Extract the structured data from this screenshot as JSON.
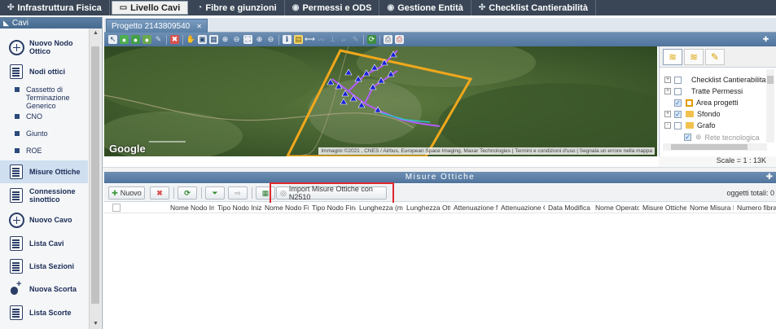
{
  "top_nav": {
    "items": [
      {
        "label": "Infrastruttura Fisica",
        "icon": "network-icon",
        "active": false
      },
      {
        "label": "Livello Cavi",
        "icon": "cable-icon",
        "active": true
      },
      {
        "label": "Fibre e giunzioni",
        "icon": "fiber-icon",
        "active": false
      },
      {
        "label": "Permessi e ODS",
        "icon": "permit-icon",
        "active": false
      },
      {
        "label": "Gestione Entità",
        "icon": "entity-icon",
        "active": false
      },
      {
        "label": "Checklist Cantierabilità",
        "icon": "checklist-icon",
        "active": false
      }
    ]
  },
  "sidebar": {
    "title": "Cavi",
    "items": [
      {
        "label": "Nuovo Nodo Ottico",
        "icon": "plus-circle-icon"
      },
      {
        "label": "Nodi ottici",
        "icon": "document-list-icon"
      },
      {
        "label": "Cassetto di Terminazione Generico",
        "icon": "square-bullet-icon"
      },
      {
        "label": "CNO",
        "icon": "square-bullet-icon"
      },
      {
        "label": "Giunto",
        "icon": "square-bullet-icon"
      },
      {
        "label": "ROE",
        "icon": "square-bullet-icon"
      },
      {
        "label": "Misure Ottiche",
        "icon": "document-list-icon",
        "selected": true
      },
      {
        "label": "Connessione sinottico",
        "icon": "document-list-icon"
      },
      {
        "label": "Nuovo Cavo",
        "icon": "plus-circle-icon"
      },
      {
        "label": "Lista Cavi",
        "icon": "document-list-icon"
      },
      {
        "label": "Lista Sezioni",
        "icon": "document-list-icon"
      },
      {
        "label": "Nuova Scorta",
        "icon": "scorta-icon"
      },
      {
        "label": "Lista Scorte",
        "icon": "document-list-icon"
      }
    ]
  },
  "project_tab": {
    "label": "Progetto 2143809540"
  },
  "map": {
    "logo": "Google",
    "attribution": "Immagini ©2021 , CNES / Airbus, European Space Imaging, Maxar Technologies  |  Termini e condizioni d'uso  |  Segnala un errore nella mappa",
    "scale": "Scale = 1 : 13K",
    "area_color": "#f0a81c",
    "route_color": "#b45cff",
    "node_color": "#1a1fd6"
  },
  "layers": {
    "items": [
      {
        "label": "Checklist Cantierabilita'",
        "checked": false,
        "expander": "+"
      },
      {
        "label": "Tratte Permessi",
        "checked": false,
        "expander": "+"
      },
      {
        "label": "Area progetti",
        "checked": true,
        "expander": ""
      },
      {
        "label": "Sfondo",
        "checked": true,
        "expander": "+"
      },
      {
        "label": "Grafo",
        "checked": false,
        "expander": "-"
      },
      {
        "label": "Rete tecnologica",
        "checked": true,
        "expander": ""
      }
    ]
  },
  "misure": {
    "title": "Misure Ottiche",
    "toolbar": {
      "new_label": "Nuovo",
      "import_label": "Import Misure Ottiche con N2510",
      "totals": "oggetti totali: 0"
    },
    "columns": [
      "Nome Nodo Iniz",
      "Tipo Nodo Inizia",
      "Nome Nodo Fin",
      "Tipo Nodo Final",
      "Lunghezza (m)",
      "Lunghezza Otti",
      "Attenuazione M",
      "Attenuazione O",
      "Data Modifica",
      "Nome Operator",
      "Misure Ottiche N",
      "Nome Misura In",
      "Numero fibra"
    ]
  }
}
